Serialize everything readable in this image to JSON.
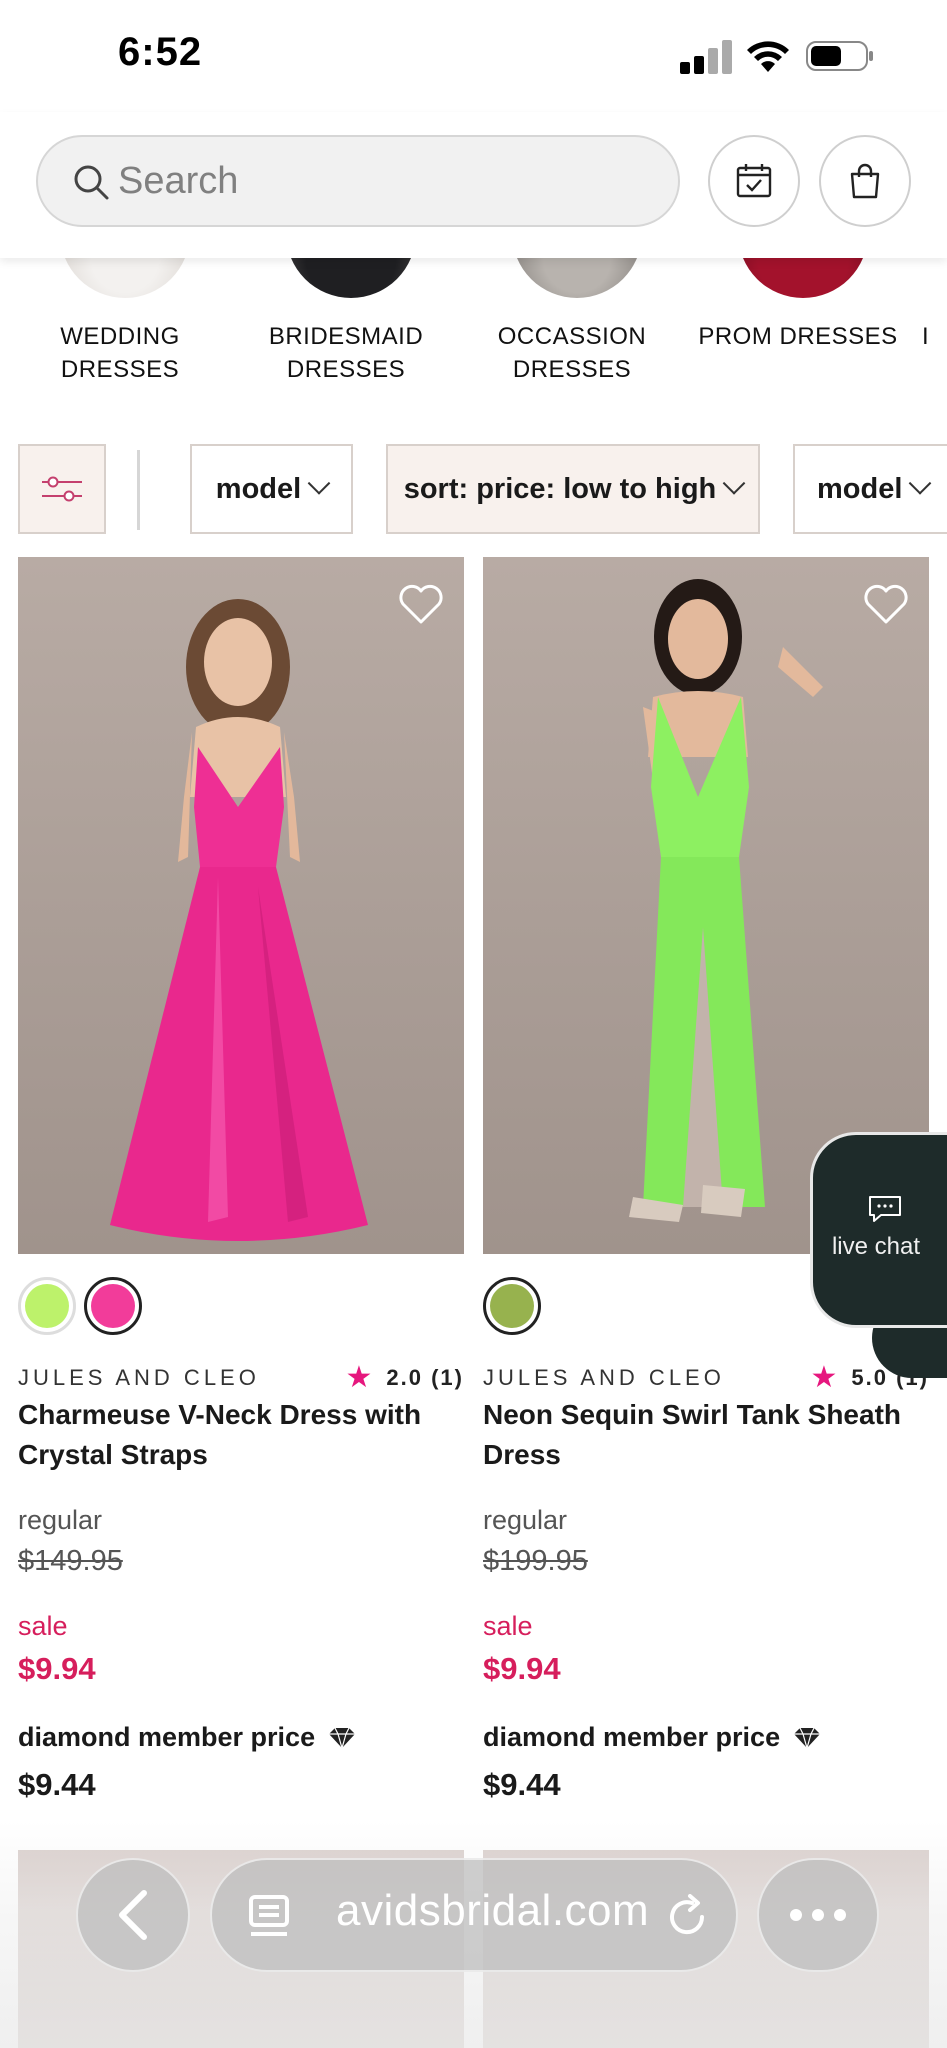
{
  "status_bar": {
    "time": "6:52"
  },
  "header": {
    "search_placeholder": "Search"
  },
  "categories": [
    {
      "label": "WEDDING\nDRESSES"
    },
    {
      "label": "BRIDESMAID\nDRESSES"
    },
    {
      "label": "OCCASSION\nDRESSES"
    },
    {
      "label": "PROM DRESSES"
    }
  ],
  "filters": {
    "model_label": "model",
    "sort_label": "sort: price: low to high",
    "model2_label": "model"
  },
  "products": [
    {
      "brand": "JULES AND CLEO",
      "rating": "2.0 (1)",
      "name": "Charmeuse V-Neck Dress with Crystal Straps",
      "regular_label": "regular",
      "regular_price": "$149.95",
      "sale_label": "sale",
      "sale_price": "$9.94",
      "member_label": "diamond member price",
      "member_price": "$9.44",
      "swatches": [
        "#bdf26b",
        "#f23c9a"
      ],
      "dress_color": "#ee2f94"
    },
    {
      "brand": "JULES AND CLEO",
      "rating": "5.0 (1)",
      "name": "Neon Sequin Swirl Tank Sheath Dress",
      "regular_label": "regular",
      "regular_price": "$199.95",
      "sale_label": "sale",
      "sale_price": "$9.94",
      "member_label": "diamond member price",
      "member_price": "$9.44",
      "swatches": [
        "#97b24e"
      ],
      "dress_color": "#8df061"
    }
  ],
  "live_chat": {
    "label": "live chat"
  },
  "browser": {
    "url": "avidsbridal.com"
  },
  "colors": {
    "accent_pink": "#d61e5c",
    "star_pink": "#e6177e",
    "chat_bg": "#1e2b2a"
  }
}
